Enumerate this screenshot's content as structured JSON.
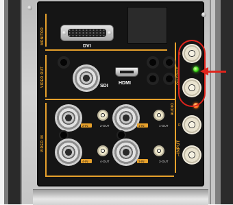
{
  "sections": {
    "monitor": "MONITOR",
    "video_out": "VIDEO OUT",
    "video_in": "VIDEO IN",
    "audio": "AUDIO"
  },
  "ports": {
    "dvi": "DVI",
    "sdi": "SDI",
    "hdmi": "HDMI",
    "output": "OUTPUT",
    "input": "INPUT",
    "output_r": "R",
    "output_l": "L",
    "input_r": "R",
    "input_l": "L",
    "in_1": "1-IN",
    "out_1": "1-OUT",
    "in_2": "2-IN",
    "out_2": "2-OUT",
    "in_3": "3-IN",
    "out_3": "3-OUT",
    "in_4": "4-IN",
    "out_4": "4-OUT"
  },
  "annotation": {
    "highlight_color": "#e0241c"
  },
  "colors": {
    "label_orange": "#e7a12b",
    "led_green": "#31d410",
    "led_orange": "#ff6d16"
  }
}
